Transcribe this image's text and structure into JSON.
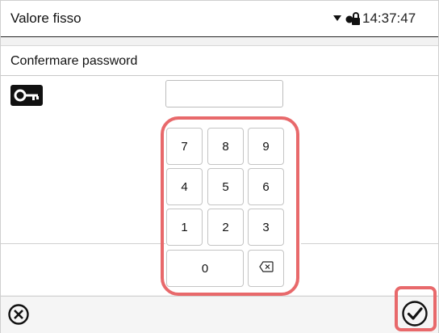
{
  "statusbar": {
    "title": "Valore fisso",
    "time": "14:37:47",
    "icons": [
      "dropdown-arrow-icon",
      "user-lock-icon"
    ]
  },
  "dialog": {
    "title": "Confermare password",
    "icon": "key-icon",
    "password_value": ""
  },
  "keypad": {
    "rows": [
      [
        "7",
        "8",
        "9"
      ],
      [
        "4",
        "5",
        "6"
      ],
      [
        "1",
        "2",
        "3"
      ]
    ],
    "zero": "0",
    "backspace_icon": "backspace-icon"
  },
  "bottombar": {
    "cancel_icon": "cancel-circle-x-icon",
    "confirm_icon": "confirm-circle-check-icon"
  },
  "colors": {
    "highlight": "#e8696b",
    "status_border": "#222222"
  }
}
